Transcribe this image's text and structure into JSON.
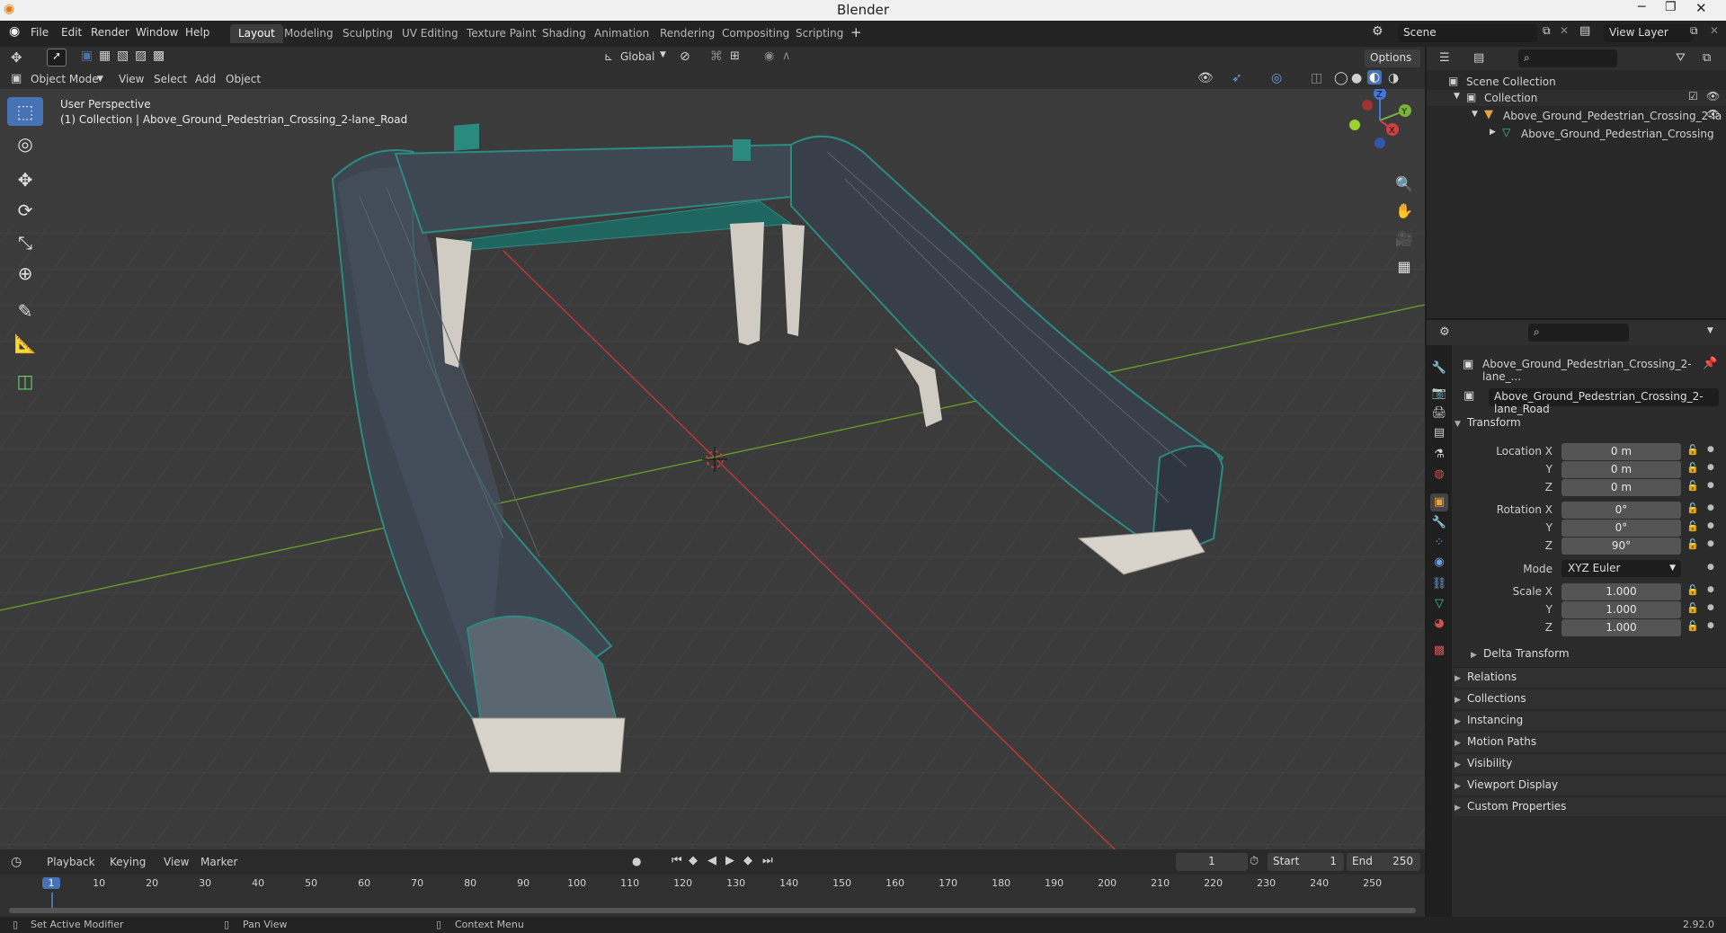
{
  "titlebar": {
    "title": "Blender"
  },
  "menu": {
    "file": "File",
    "edit": "Edit",
    "render": "Render",
    "window": "Window",
    "help": "Help"
  },
  "workspaces": [
    "Layout",
    "Modeling",
    "Sculpting",
    "UV Editing",
    "Texture Paint",
    "Shading",
    "Animation",
    "Rendering",
    "Compositing",
    "Scripting"
  ],
  "scene": {
    "name": "Scene",
    "view_layer": "View Layer"
  },
  "viewport": {
    "mode": "Object Mode",
    "view": "View",
    "select": "Select",
    "add": "Add",
    "object": "Object",
    "orientation": "Global",
    "options": "Options",
    "info_line1": "User Perspective",
    "info_line2": "(1) Collection | Above_Ground_Pedestrian_Crossing_2-lane_Road"
  },
  "gizmo": {
    "z": "Z",
    "y": "Y",
    "x": "X"
  },
  "outliner": {
    "scene_collection": "Scene Collection",
    "collection": "Collection",
    "object": "Above_Ground_Pedestrian_Crossing_2-la",
    "mesh": "Above_Ground_Pedestrian_Crossing"
  },
  "properties": {
    "object_name_short": "Above_Ground_Pedestrian_Crossing_2-lane_...",
    "object_name": "Above_Ground_Pedestrian_Crossing_2-lane_Road",
    "transform": "Transform",
    "location_label": "Location X",
    "y": "Y",
    "z": "Z",
    "location": [
      "0 m",
      "0 m",
      "0 m"
    ],
    "rotation_label": "Rotation X",
    "rotation": [
      "0°",
      "0°",
      "90°"
    ],
    "mode_label": "Mode",
    "mode": "XYZ Euler",
    "scale_label": "Scale X",
    "scale": [
      "1.000",
      "1.000",
      "1.000"
    ],
    "delta": "Delta Transform",
    "panels": [
      "Relations",
      "Collections",
      "Instancing",
      "Motion Paths",
      "Visibility",
      "Viewport Display",
      "Custom Properties"
    ]
  },
  "timeline": {
    "playback": "Playback",
    "keying": "Keying",
    "view": "View",
    "marker": "Marker",
    "current": "1",
    "start_label": "Start",
    "start": "1",
    "end_label": "End",
    "end": "250",
    "ticks": [
      "1",
      "10",
      "20",
      "30",
      "40",
      "50",
      "60",
      "70",
      "80",
      "90",
      "100",
      "110",
      "120",
      "130",
      "140",
      "150",
      "160",
      "170",
      "180",
      "190",
      "200",
      "210",
      "220",
      "230",
      "240",
      "250"
    ]
  },
  "status": {
    "left": "Set Active Modifier",
    "mid": "Pan View",
    "right": "Context Menu",
    "version": "2.92.0"
  },
  "colors": {
    "accent": "#4772b3",
    "x_axis": "#c0393b",
    "y_axis": "#6a9a2a"
  }
}
